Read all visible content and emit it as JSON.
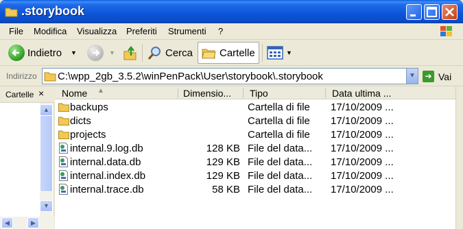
{
  "window": {
    "title": ".storybook"
  },
  "menu": [
    "File",
    "Modifica",
    "Visualizza",
    "Preferiti",
    "Strumenti",
    "?"
  ],
  "toolbar": {
    "back_label": "Indietro",
    "search_label": "Cerca",
    "folders_label": "Cartelle"
  },
  "address": {
    "label": "Indirizzo",
    "path": "C:\\wpp_2gb_3.5.2\\winPenPack\\User\\storybook\\.storybook",
    "go_label": "Vai"
  },
  "left_pane": {
    "title": "Cartelle",
    "close_glyph": "×"
  },
  "columns": {
    "name": "Nome",
    "size": "Dimensio...",
    "type": "Tipo",
    "date": "Data ultima ..."
  },
  "files": [
    {
      "name": "backups",
      "size": "",
      "type": "Cartella di file",
      "date": "17/10/2009 ...",
      "icon": "folder-icon"
    },
    {
      "name": "dicts",
      "size": "",
      "type": "Cartella di file",
      "date": "17/10/2009 ...",
      "icon": "folder-icon"
    },
    {
      "name": "projects",
      "size": "",
      "type": "Cartella di file",
      "date": "17/10/2009 ...",
      "icon": "folder-icon"
    },
    {
      "name": "internal.9.log.db",
      "size": "128 KB",
      "type": "File del data...",
      "date": "17/10/2009 ...",
      "icon": "db-file-icon"
    },
    {
      "name": "internal.data.db",
      "size": "129 KB",
      "type": "File del data...",
      "date": "17/10/2009 ...",
      "icon": "db-file-icon"
    },
    {
      "name": "internal.index.db",
      "size": "129 KB",
      "type": "File del data...",
      "date": "17/10/2009 ...",
      "icon": "db-file-icon"
    },
    {
      "name": "internal.trace.db",
      "size": "58 KB",
      "type": "File del data...",
      "date": "17/10/2009 ...",
      "icon": "db-file-icon"
    }
  ],
  "colors": {
    "titlebar": "#0a55d8",
    "window_bg": "#ece9d8",
    "folder": "#f3c955"
  }
}
